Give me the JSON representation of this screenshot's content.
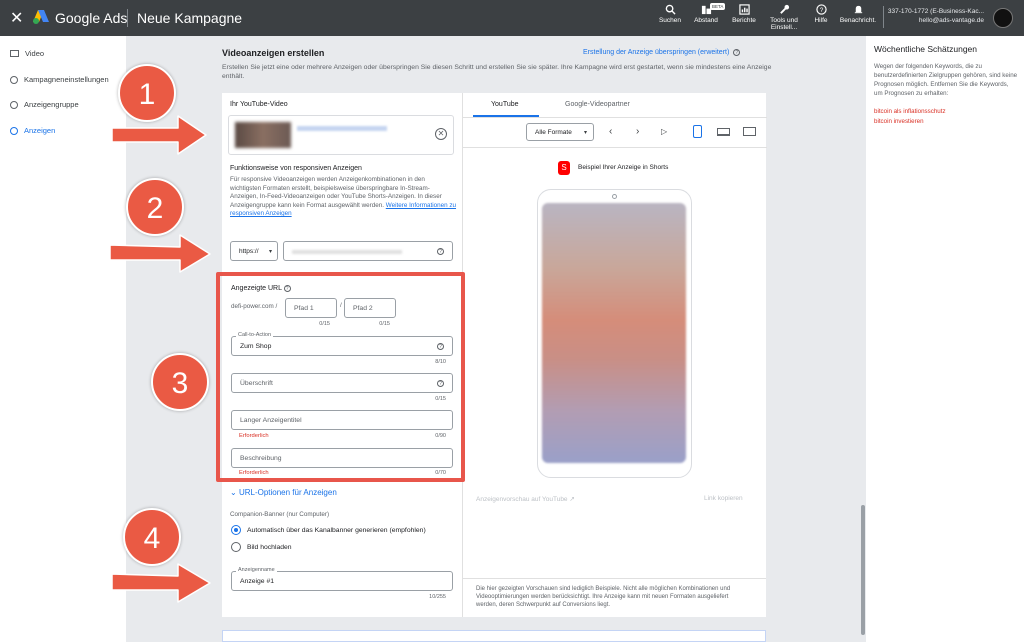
{
  "header": {
    "close_icon": "close-icon",
    "brand": "Google Ads",
    "campaign_title": "Neue Kampagne",
    "tools": [
      {
        "label": "Suchen",
        "icon": "search-icon"
      },
      {
        "label": "Abstand",
        "icon": "appearance-icon",
        "badge": "BETA"
      },
      {
        "label": "Berichte",
        "icon": "reports-icon"
      },
      {
        "label": "Tools und Einstell...",
        "icon": "wrench-icon"
      },
      {
        "label": "Hilfe",
        "icon": "help-icon"
      },
      {
        "label": "Benachricht.",
        "icon": "bell-icon"
      }
    ],
    "account_line1": "337-170-1772 (E-Business-Kac...",
    "account_line2": "hello@ads-vantage.de"
  },
  "leftnav": {
    "items": [
      {
        "label": "Video"
      },
      {
        "label": "Kampagneneinstellungen"
      },
      {
        "label": "Anzeigengruppe"
      },
      {
        "label": "Anzeigen"
      }
    ]
  },
  "main": {
    "title": "Videoanzeigen erstellen",
    "skip_link": "Erstellung der Anzeige überspringen (erweitert)",
    "intro": "Erstellen Sie jetzt eine oder mehrere Anzeigen oder überspringen Sie diesen Schritt und erstellen Sie sie später. Ihre Kampagne wird erst gestartet, wenn sie mindestens eine Anzeige enthält.",
    "youtube_label": "Ihr YouTube-Video",
    "responsive_title": "Funktionsweise von responsiven Anzeigen",
    "responsive_text": "Für responsive Videoanzeigen werden Anzeigenkombinationen in den wichtigsten Formaten erstellt, beispielsweise überspringbare In-Stream-Anzeigen, In-Feed-Videoanzeigen oder YouTube Shorts-Anzeigen. In dieser Anzeigengruppe kann kein Format ausgewählt werden.",
    "responsive_link": "Weitere Informationen zu responsiven Anzeigen",
    "protocol": "https://",
    "display_url_label": "Angezeigte URL",
    "domain": "defi-power.com /",
    "path1": "Pfad 1",
    "path2": "Pfad 2",
    "path1_count": "0/15",
    "path2_count": "0/15",
    "cta_label": "Call-to-Action",
    "cta_value": "Zum Shop",
    "cta_count": "8/10",
    "headline_ph": "Überschrift",
    "headline_count": "0/15",
    "long_headline_ph": "Langer Anzeigentitel",
    "long_headline_req": "Erforderlich",
    "long_headline_count": "0/90",
    "description_ph": "Beschreibung",
    "description_req": "Erforderlich",
    "description_count": "0/70",
    "url_options": "URL-Optionen für Anzeigen",
    "banner_label": "Companion-Banner (nur Computer)",
    "banner_auto": "Automatisch über das Kanalbanner generieren (empfohlen)",
    "banner_upload": "Bild hochladen",
    "adname_label": "Anzeigenname",
    "adname_value": "Anzeige #1",
    "adname_count": "10/255"
  },
  "preview": {
    "tabs": [
      "YouTube",
      "Google-Videopartner"
    ],
    "format_select": "Alle Formate",
    "shorts_label": "Beispiel Ihrer Anzeige in Shorts",
    "yt_preview": "Anzeigenvorschau auf YouTube",
    "copy_link": "Link kopieren",
    "note": "Die hier gezeigten Vorschauen sind lediglich Beispiele. Nicht alle möglichen Kombinationen und Videooptimierungen werden berücksichtigt. Ihre Anzeige kann mit neuen Formaten ausgeliefert werden, deren Schwerpunkt auf Conversions liegt."
  },
  "rightpanel": {
    "title": "Wöchentliche Schätzungen",
    "text": "Wegen der folgenden Keywords, die zu benutzerdefinierten Zielgruppen gehören, sind keine Prognosen möglich. Entfernen Sie die Keywords, um Prognosen zu erhalten:",
    "keywords": [
      "bitcoin als inflationsschutz",
      "bitcoin investieren"
    ]
  },
  "steps": [
    "1",
    "2",
    "3",
    "4"
  ],
  "colors": {
    "accent": "#1a73e8",
    "step": "#ea5a44",
    "error": "#d93025",
    "topbar": "#3c4043"
  }
}
